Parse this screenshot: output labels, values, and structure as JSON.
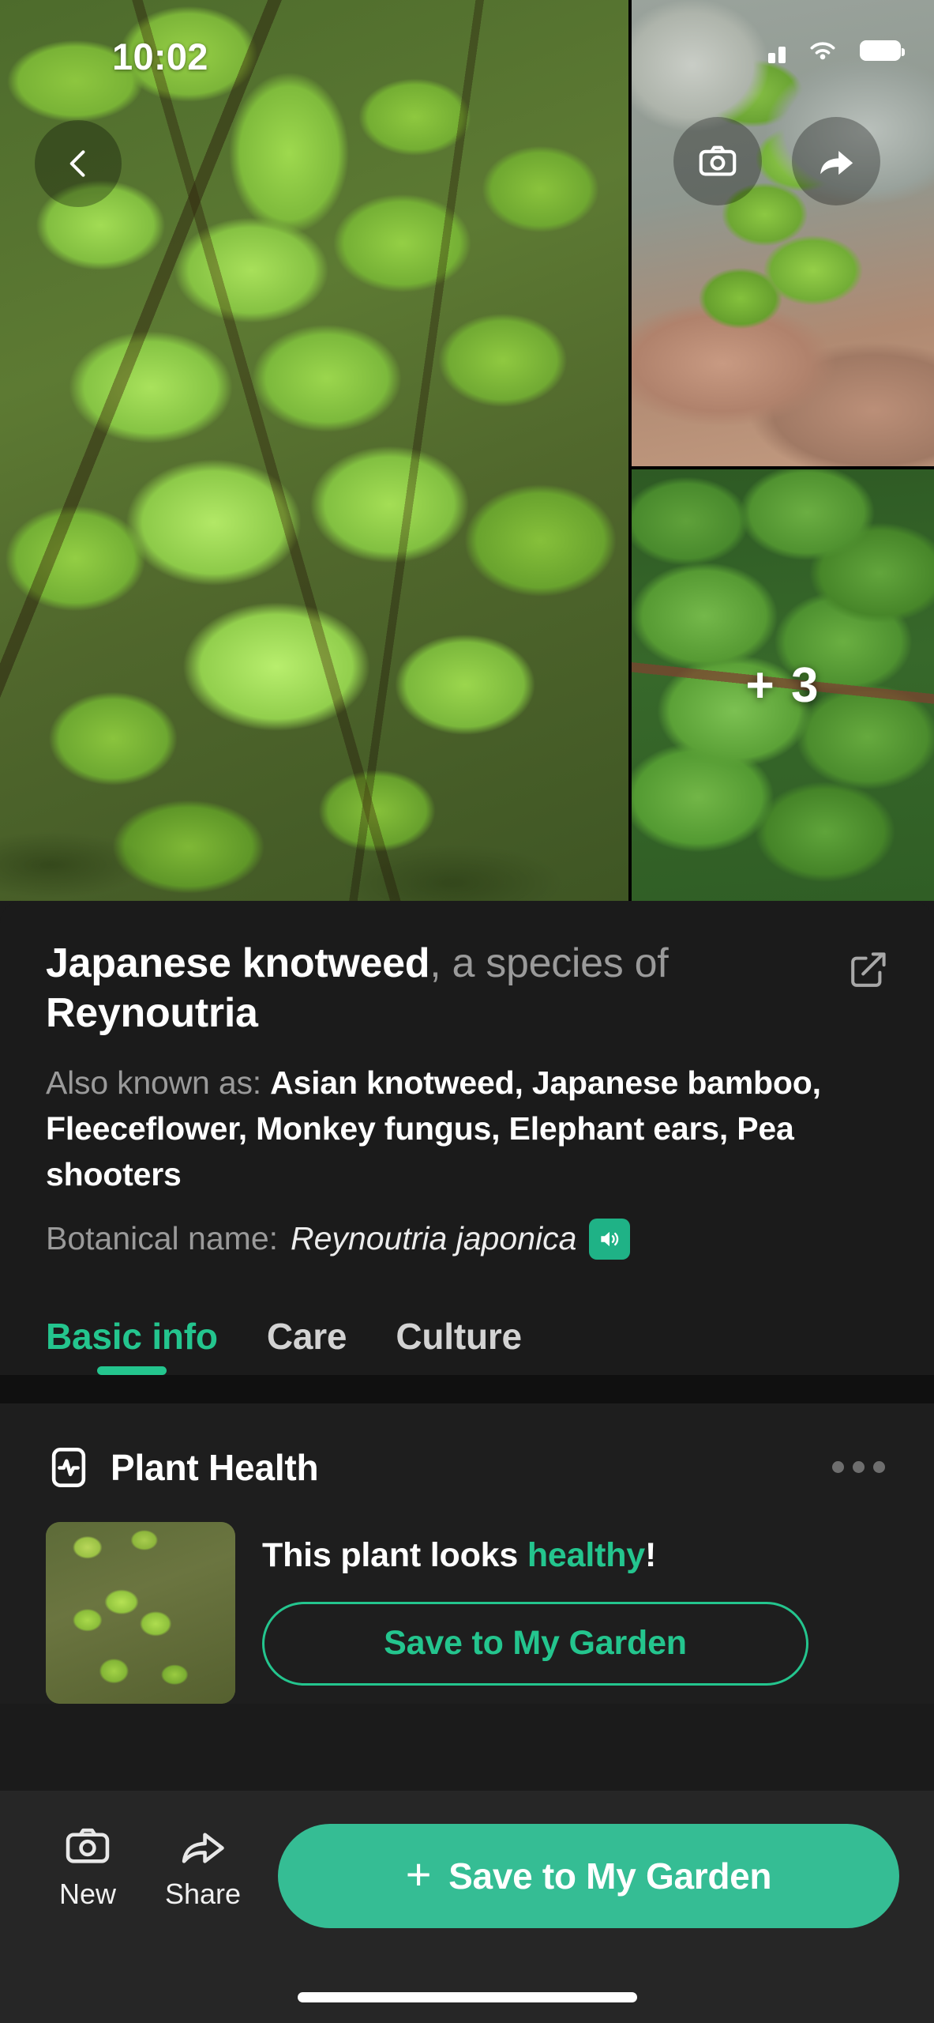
{
  "status_bar": {
    "time": "10:02",
    "icons": [
      "cellular-signal",
      "wifi",
      "battery"
    ]
  },
  "photo_gallery": {
    "back_label": "Back",
    "camera_label": "Camera",
    "share_label": "Share",
    "more_photos_badge": "+ 3",
    "photo_count_hidden": 3
  },
  "plant": {
    "title_common": "Japanese knotweed",
    "title_mid": ", a species",
    "title_of": "of ",
    "title_genus": "Reynoutria",
    "aka_label": "Also known as: ",
    "aka_values": "Asian knotweed, Japanese bamboo, Fleeceflower, Monkey fungus, Elephant ears, Pea shooters",
    "botanical_label": "Botanical name:",
    "botanical_name": "Reynoutria japonica",
    "pronounce_icon": "speaker-icon",
    "edit_icon": "edit-square-icon"
  },
  "tabs": [
    {
      "label": "Basic info",
      "active": true
    },
    {
      "label": "Care",
      "active": false
    },
    {
      "label": "Culture",
      "active": false
    }
  ],
  "plant_health": {
    "section_title": "Plant Health",
    "section_icon": "pulse-icon",
    "more_icon": "more-horizontal-icon",
    "status_prefix": "This plant looks ",
    "status_value": "healthy",
    "status_suffix": "!",
    "save_button_label": "Save to My Garden"
  },
  "bottom_bar": {
    "new_label": "New",
    "new_icon": "camera-icon",
    "share_label": "Share",
    "share_icon": "share-arrow-icon",
    "primary_plus": "+",
    "primary_label": "Save to My Garden"
  },
  "colors": {
    "accent_green": "#24c58e",
    "primary_button": "#35bd94",
    "speaker_green": "#1fb286",
    "panel_bg": "#1b1b1b",
    "card_bg": "#1e1e1e",
    "bottom_bar_bg": "#262626",
    "muted_text": "#9a9a9a"
  }
}
